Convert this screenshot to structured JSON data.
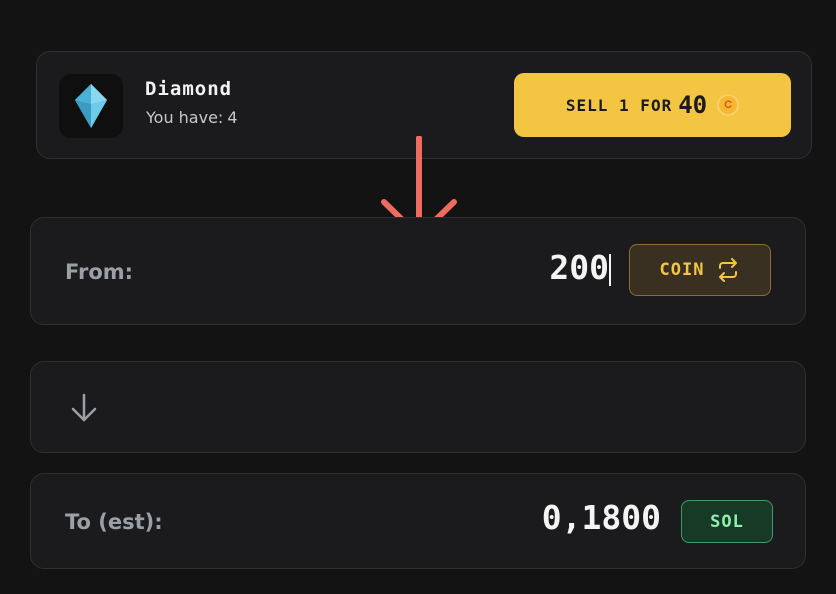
{
  "item": {
    "name": "Diamond",
    "owned_label": "You have:",
    "owned_count": "4",
    "icon": "diamond-icon"
  },
  "sell_button": {
    "label": "SELL 1 FOR",
    "price": "40",
    "currency_icon": "coin-icon",
    "currency_letter": "C"
  },
  "from": {
    "label": "From:",
    "amount": "200",
    "currency_label": "COIN",
    "swap_icon": "swap-icon"
  },
  "direction_icon": "arrow-down-icon",
  "to": {
    "label": "To (est):",
    "amount": "0,1800",
    "currency_label": "SOL"
  },
  "colors": {
    "accent_yellow": "#f4c443",
    "success_green": "#8ff0b0",
    "annotation_red": "#ef6b62"
  }
}
